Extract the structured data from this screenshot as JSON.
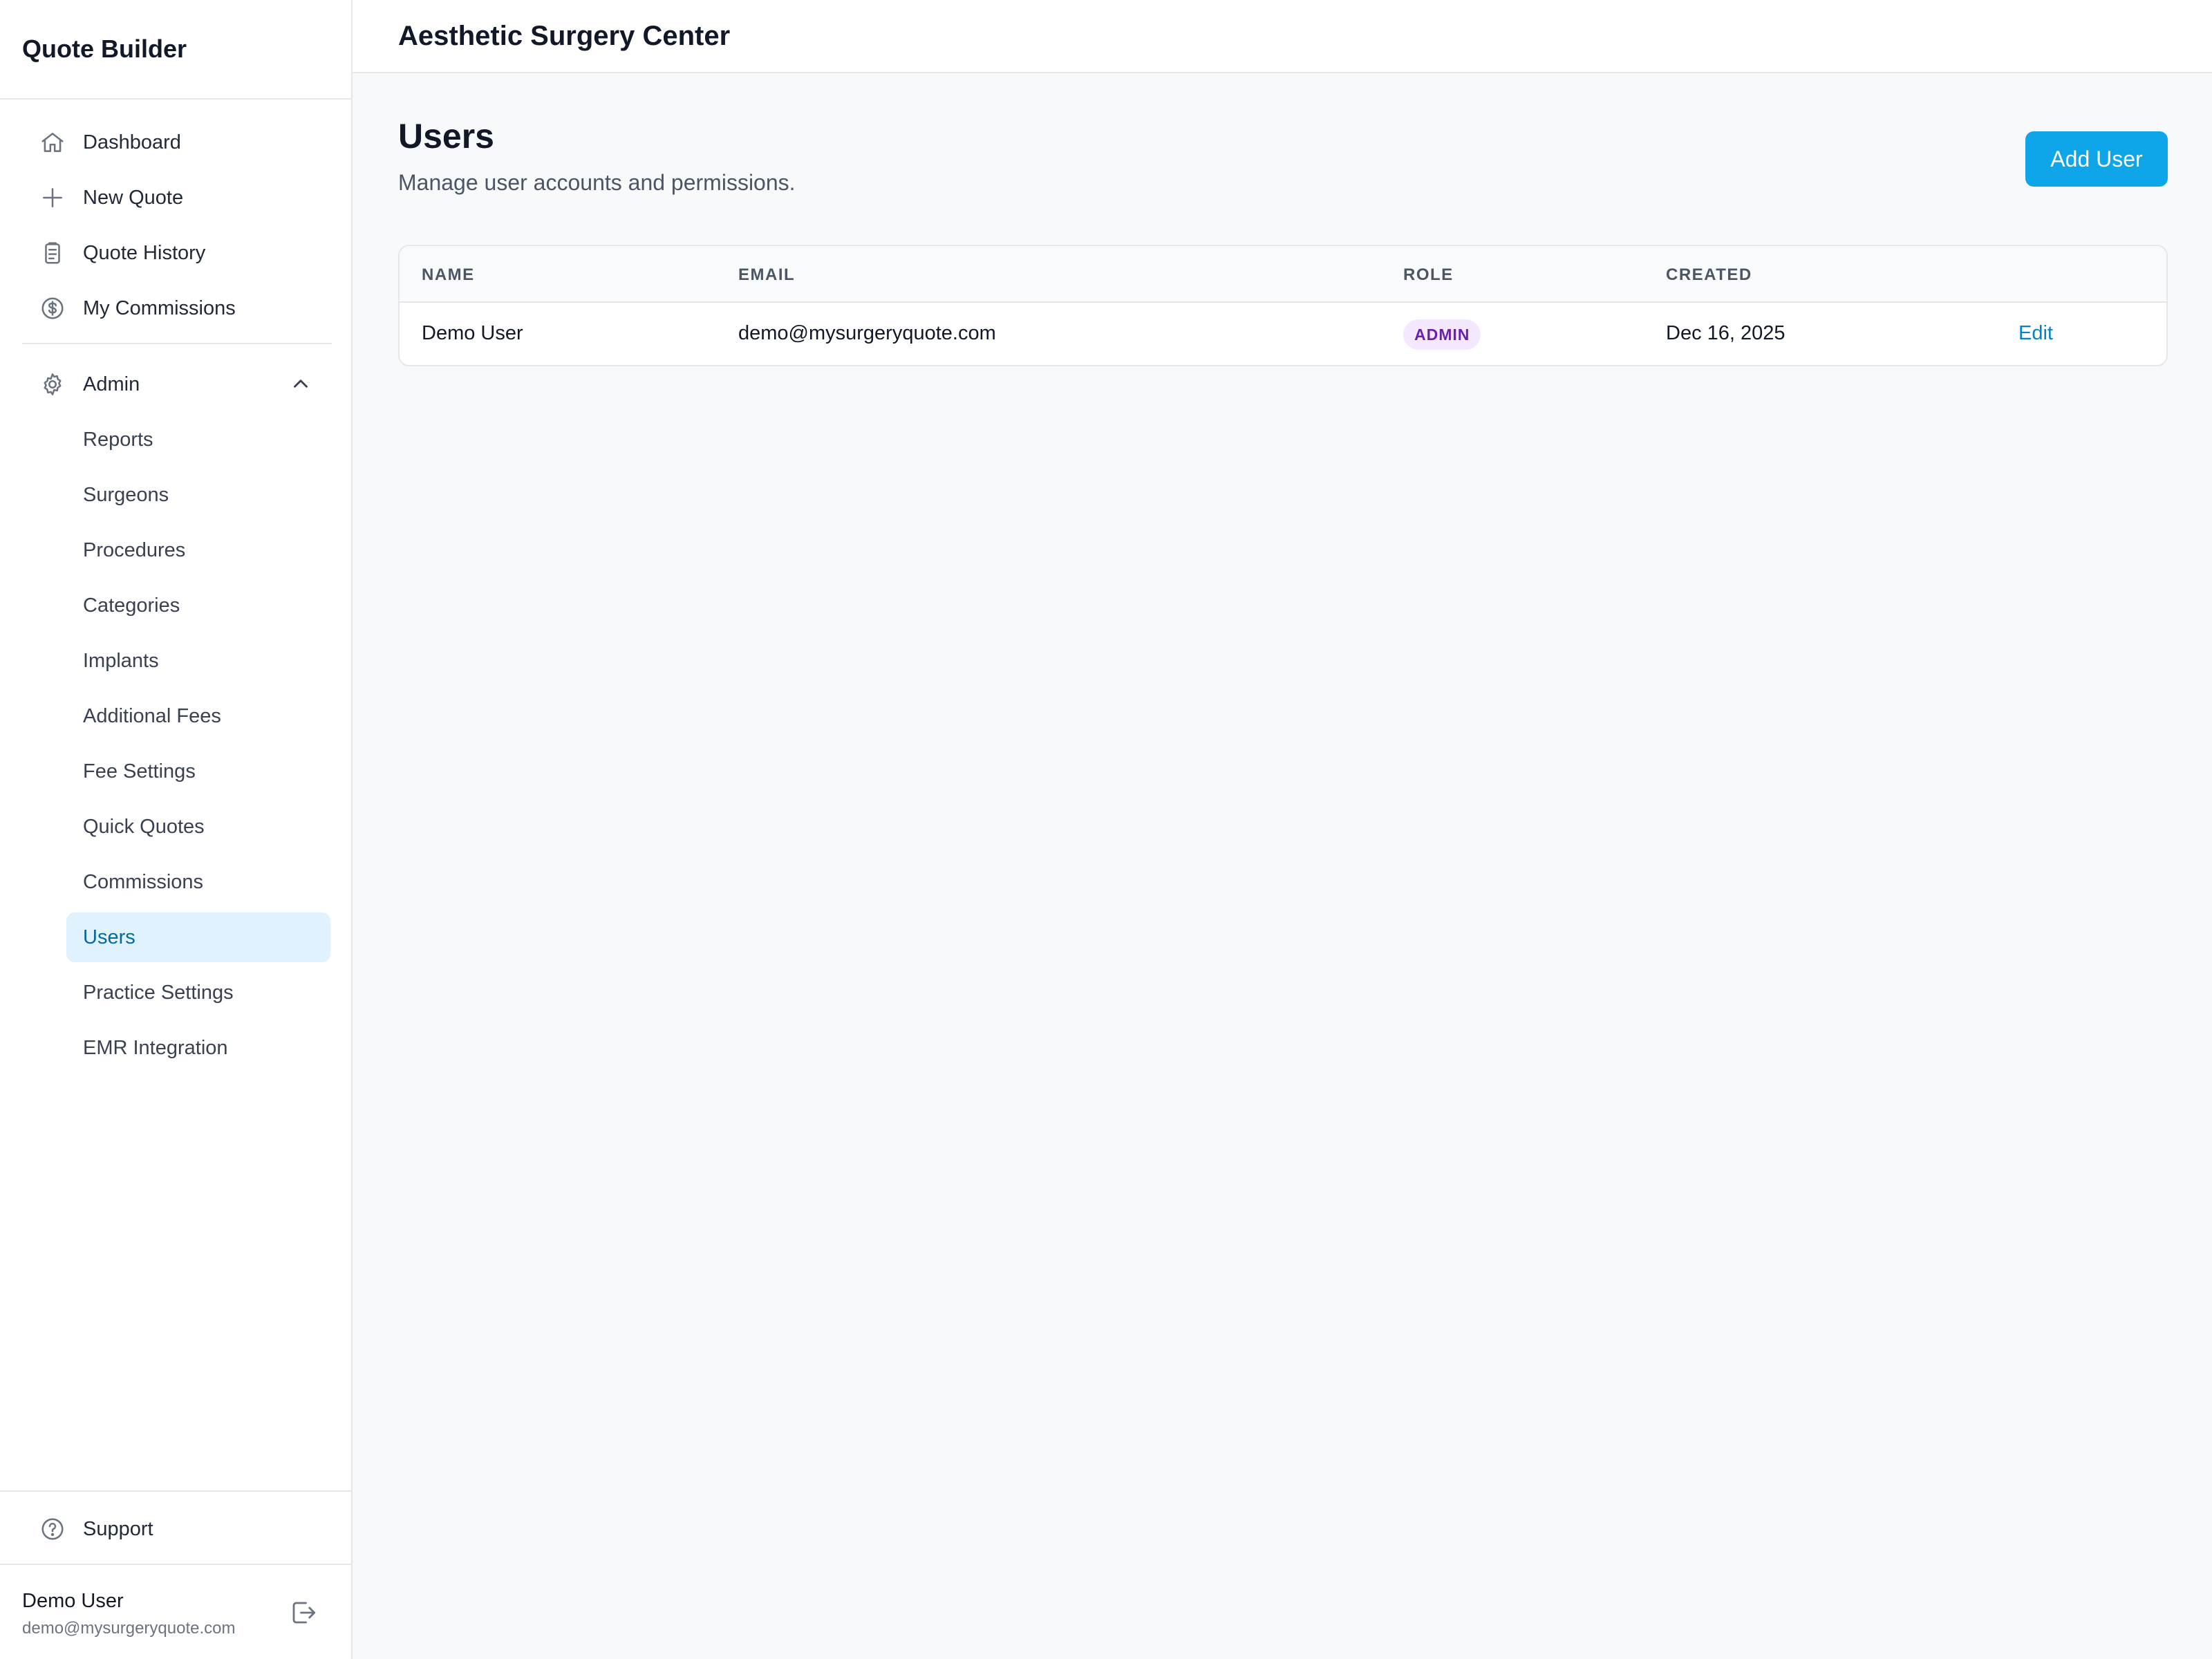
{
  "brand": "Quote Builder",
  "nav": {
    "primary": [
      {
        "label": "Dashboard",
        "icon": "home-icon"
      },
      {
        "label": "New Quote",
        "icon": "plus-icon"
      },
      {
        "label": "Quote History",
        "icon": "clipboard-icon"
      },
      {
        "label": "My Commissions",
        "icon": "dollar-icon"
      }
    ],
    "admin": {
      "label": "Admin",
      "icon": "gear-icon",
      "expanded": true,
      "items": [
        {
          "label": "Reports"
        },
        {
          "label": "Surgeons"
        },
        {
          "label": "Procedures"
        },
        {
          "label": "Categories"
        },
        {
          "label": "Implants"
        },
        {
          "label": "Additional Fees"
        },
        {
          "label": "Fee Settings"
        },
        {
          "label": "Quick Quotes"
        },
        {
          "label": "Commissions"
        },
        {
          "label": "Users",
          "active": true
        },
        {
          "label": "Practice Settings"
        },
        {
          "label": "EMR Integration"
        }
      ]
    },
    "support": {
      "label": "Support",
      "icon": "question-icon"
    }
  },
  "current_user": {
    "name": "Demo User",
    "email": "demo@mysurgeryquote.com"
  },
  "topbar": {
    "title": "Aesthetic Surgery Center"
  },
  "page": {
    "title": "Users",
    "subtitle": "Manage user accounts and permissions.",
    "add_button": "Add User"
  },
  "table": {
    "columns": [
      "NAME",
      "EMAIL",
      "ROLE",
      "CREATED"
    ],
    "rows": [
      {
        "name": "Demo User",
        "email": "demo@mysurgeryquote.com",
        "role": "ADMIN",
        "created": "Dec 16, 2025",
        "action": "Edit"
      }
    ]
  },
  "colors": {
    "accent": "#0ea5e9",
    "active_nav_bg": "#e0f2fe",
    "active_nav_text": "#0369a1",
    "role_badge_bg": "#f3e8ff",
    "role_badge_text": "#6b21a8",
    "link": "#0284c7"
  }
}
